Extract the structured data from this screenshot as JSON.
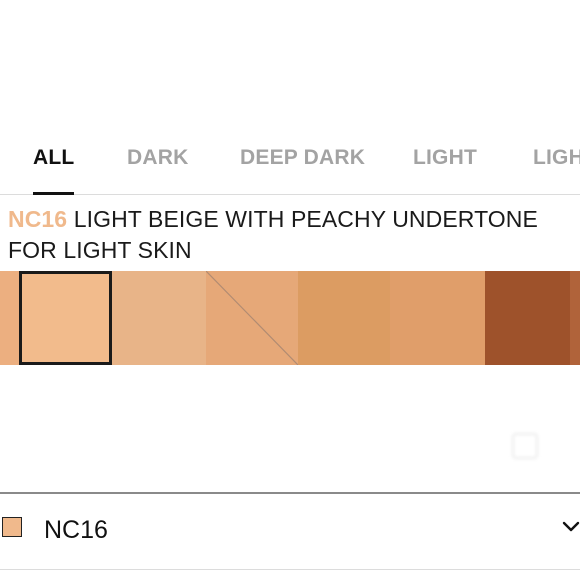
{
  "tabs": [
    {
      "label": "ALL",
      "active": true
    },
    {
      "label": "DARK",
      "active": false
    },
    {
      "label": "DEEP DARK",
      "active": false
    },
    {
      "label": "LIGHT",
      "active": false
    },
    {
      "label": "LIGH",
      "active": false
    }
  ],
  "shade": {
    "code": "NC16",
    "description_line1": "LIGHT BEIGE WITH PEACHY UNDERTONE",
    "description_line2": "FOR LIGHT SKIN"
  },
  "swatches": [
    {
      "color": "#ecaf80",
      "selected": false,
      "unavailable": false
    },
    {
      "color": "#f2bb8c",
      "selected": true,
      "unavailable": false
    },
    {
      "color": "#e8b488",
      "selected": false,
      "unavailable": false
    },
    {
      "color": "#e6a878",
      "selected": false,
      "unavailable": true
    },
    {
      "color": "#dc9c62",
      "selected": false,
      "unavailable": false
    },
    {
      "color": "#e09e6a",
      "selected": false,
      "unavailable": false
    },
    {
      "color": "#9e522b",
      "selected": false,
      "unavailable": false
    },
    {
      "color": "#b0633a",
      "selected": false,
      "unavailable": false
    }
  ],
  "selector": {
    "label": "NC16",
    "chip_color": "#f0b98c",
    "icon": "chevron-down-icon"
  },
  "colors": {
    "accent": "#f0b98c",
    "active_tab": "#111111",
    "inactive_tab": "#a3a3a3"
  }
}
